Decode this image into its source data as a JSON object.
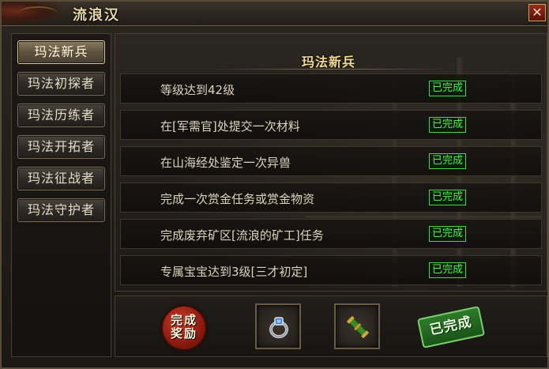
{
  "window": {
    "title": "流浪汉",
    "close_label": "✕"
  },
  "sidebar": {
    "items": [
      {
        "label": "玛法新兵",
        "active": true
      },
      {
        "label": "玛法初探者",
        "active": false
      },
      {
        "label": "玛法历练者",
        "active": false
      },
      {
        "label": "玛法开拓者",
        "active": false
      },
      {
        "label": "玛法征战者",
        "active": false
      },
      {
        "label": "玛法守护者",
        "active": false
      }
    ]
  },
  "main": {
    "header": "玛法新兵",
    "tasks": [
      {
        "text": "等级达到42级",
        "status": "已完成"
      },
      {
        "text": "在[军需官]处提交一次材料",
        "status": "已完成"
      },
      {
        "text": "在山海经处鉴定一次异兽",
        "status": "已完成"
      },
      {
        "text": "完成一次赏金任务或赏金物资",
        "status": "已完成"
      },
      {
        "text": "完成废弃矿区[流浪的矿工]任务",
        "status": "已完成"
      },
      {
        "text": "专属宝宝达到3级[三才初定]",
        "status": "已完成"
      }
    ]
  },
  "reward": {
    "seal_line1": "完成",
    "seal_line2": "奖励",
    "items": [
      {
        "icon": "ring-icon"
      },
      {
        "icon": "scroll-icon"
      }
    ],
    "stamp": "已完成"
  },
  "colors": {
    "status_green": "#4cf04c",
    "title_gold": "#f2d890",
    "seal_red": "#c93a26",
    "stamp_green": "#2d7a2a"
  }
}
